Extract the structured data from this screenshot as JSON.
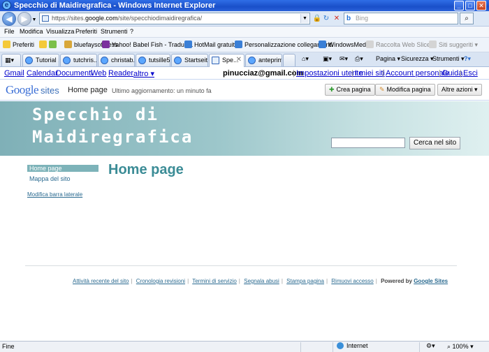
{
  "window": {
    "title": "Specchio di Maidiregrafica - Windows Internet Explorer",
    "minimize": "_",
    "maximize": "□",
    "close": "✕"
  },
  "address": {
    "url_prefix": "https://sites.",
    "url_domain": "google.com",
    "url_path": "/site/specchiodimaidiregrafica/",
    "search_placeholder": "Bing"
  },
  "menu": [
    "File",
    "Modifica",
    "Visualizza",
    "Preferiti",
    "Strumenti",
    "?"
  ],
  "favorites": {
    "label": "Preferiti",
    "items": [
      "bluefaysoftness",
      "Yahoo! Babel Fish - Tradutt...",
      "HotMail gratuita",
      "Personalizzazione collegamenti",
      "WindowsMedia",
      "Raccolta Web Slice ▾",
      "Siti suggeriti ▾"
    ]
  },
  "tabs": [
    {
      "label": "Tutorial ..."
    },
    {
      "label": "tutchris..."
    },
    {
      "label": "christab..."
    },
    {
      "label": "tutsille5"
    },
    {
      "label": "Startseite"
    },
    {
      "label": "Spe..."
    },
    {
      "label": "anteprime"
    }
  ],
  "commands": {
    "page": "Pagina ▾",
    "security": "Sicurezza ▾",
    "tools": "Strumenti ▾",
    "help": "?"
  },
  "gbar": {
    "links": [
      "Gmail",
      "Calendar",
      "Documenti",
      "Web",
      "Reader",
      "altro ▾"
    ],
    "email": "pinucciaz@gmail.com",
    "right_links": [
      "Impostazioni utente",
      "I miei siti",
      "Account personale",
      "Guida",
      "Esci"
    ]
  },
  "sites": {
    "logo_google": "Google",
    "logo_sites": "sites",
    "page_name": "Home page",
    "last_update": "Ultimo aggiornamento: un minuto fa",
    "create_page": "Crea pagina",
    "edit_page": "Modifica pagina",
    "more_actions": "Altre azioni ▾"
  },
  "banner": {
    "title_line1": "Specchio di",
    "title_line2": "Maidiregrafica",
    "search_button": "Cerca nel sito"
  },
  "sidebar": {
    "home": "Home page",
    "map": "Mappa del sito",
    "edit": "Modifica barra laterale"
  },
  "content": {
    "heading": "Home page"
  },
  "footer": {
    "links": [
      "Attività recente del sito",
      "Cronologia revisioni",
      "Termini di servizio",
      "Segnala abusi",
      "Stampa pagina",
      "Rimuovi accesso"
    ],
    "powered": "Powered by",
    "gs": "Google Sites"
  },
  "status": {
    "text": "Fine",
    "zone": "Internet",
    "zoom": "100%"
  }
}
